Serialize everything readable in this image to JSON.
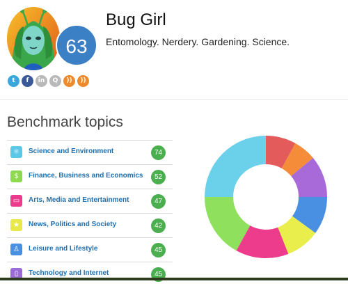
{
  "profile": {
    "name": "Bug Girl",
    "bio": "Entomology. Nerdery. Gardening. Science.",
    "score": "63"
  },
  "socials": [
    {
      "icon": "twitter-icon",
      "glyph": "t",
      "color": "#3aa6db"
    },
    {
      "icon": "facebook-icon",
      "glyph": "f",
      "color": "#3b5998"
    },
    {
      "icon": "linkedin-icon",
      "glyph": "in",
      "color": "#b9b9b9"
    },
    {
      "icon": "quora-icon",
      "glyph": "Q",
      "color": "#b9b9b9"
    },
    {
      "icon": "rss-icon",
      "glyph": "))",
      "color": "#ee8a2b"
    },
    {
      "icon": "rss-icon",
      "glyph": "))",
      "color": "#ee8a2b"
    }
  ],
  "benchmark": {
    "title": "Benchmark topics",
    "topics": [
      {
        "label": "Science and Environment",
        "count": "74",
        "icon": "atom-icon",
        "glyph": "⚛",
        "color": "#5bc8e8"
      },
      {
        "label": "Finance, Business and Economics",
        "count": "52",
        "icon": "dollar-icon",
        "glyph": "$",
        "color": "#8fd94f"
      },
      {
        "label": "Arts, Media and Entertainment",
        "count": "47",
        "icon": "tv-icon",
        "glyph": "▭",
        "color": "#ec3a8c"
      },
      {
        "label": "News, Politics and Society",
        "count": "42",
        "icon": "star-icon",
        "glyph": "★",
        "color": "#e8e84a"
      },
      {
        "label": "Leisure and Lifestyle",
        "count": "45",
        "icon": "person-icon",
        "glyph": "♙",
        "color": "#4a90e2"
      },
      {
        "label": "Technology and Internet",
        "count": "45",
        "icon": "phone-icon",
        "glyph": "▯",
        "color": "#9b6cd9"
      }
    ]
  },
  "chart_data": {
    "type": "pie",
    "style": "donut",
    "categories": [
      "Science and Environment",
      "Finance, Business and Economics",
      "Arts, Media and Entertainment",
      "News, Politics and Society",
      "Leisure and Lifestyle",
      "Technology and Internet",
      "",
      ""
    ],
    "values": [
      25,
      17,
      14,
      9,
      10,
      11,
      6,
      8
    ],
    "colors": [
      "#6bd0ea",
      "#8fe05c",
      "#ee3c8c",
      "#e9ee4c",
      "#4a90e2",
      "#a86ad9",
      "#f58c3a",
      "#e35b5b"
    ],
    "start_angle_deg": 90
  }
}
